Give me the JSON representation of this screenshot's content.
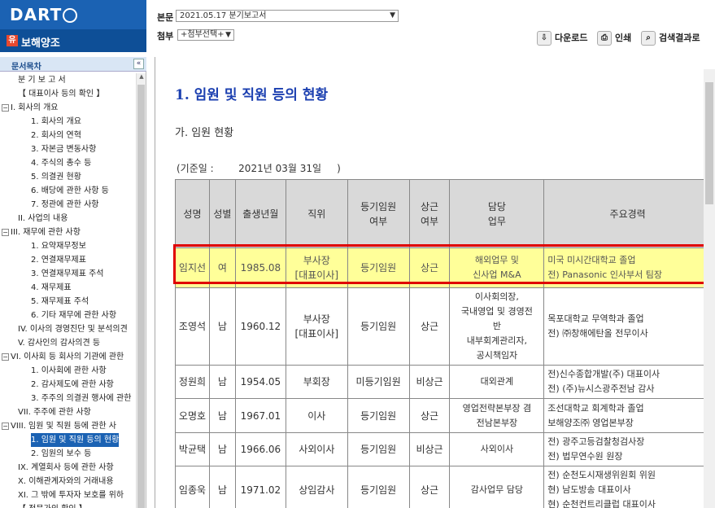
{
  "app": {
    "logo_text": "DART",
    "company": "보해양조",
    "company_icon": "유"
  },
  "header": {
    "doc_label": "본문",
    "doc_value": "2021.05.17  분기보고서",
    "attach_label": "첨부",
    "attach_value": "+첨부선택+",
    "download_label": "다운로드",
    "print_label": "인쇄",
    "search_result_label": "검색결과로"
  },
  "sidebar": {
    "title": "문서목차",
    "collapse": "«",
    "items": [
      {
        "label": "분 기 보 고 서",
        "indent": 1,
        "toggle": ""
      },
      {
        "label": "【 대표이사 등의 확인 】",
        "indent": 1,
        "toggle": ""
      },
      {
        "label": "I. 회사의 개요",
        "indent": 0,
        "toggle": "−"
      },
      {
        "label": "1. 회사의 개요",
        "indent": 2,
        "toggle": ""
      },
      {
        "label": "2. 회사의 연혁",
        "indent": 2,
        "toggle": ""
      },
      {
        "label": "3. 자본금 변동사항",
        "indent": 2,
        "toggle": ""
      },
      {
        "label": "4. 주식의 총수 등",
        "indent": 2,
        "toggle": ""
      },
      {
        "label": "5. 의결권 현황",
        "indent": 2,
        "toggle": ""
      },
      {
        "label": "6. 배당에 관한 사항 등",
        "indent": 2,
        "toggle": ""
      },
      {
        "label": "7. 정관에 관한 사항",
        "indent": 2,
        "toggle": ""
      },
      {
        "label": "II. 사업의 내용",
        "indent": 1,
        "toggle": ""
      },
      {
        "label": "III. 재무에 관한 사항",
        "indent": 0,
        "toggle": "−"
      },
      {
        "label": "1. 요약재무정보",
        "indent": 2,
        "toggle": ""
      },
      {
        "label": "2. 연결재무제표",
        "indent": 2,
        "toggle": ""
      },
      {
        "label": "3. 연결재무제표 주석",
        "indent": 2,
        "toggle": ""
      },
      {
        "label": "4. 재무제표",
        "indent": 2,
        "toggle": ""
      },
      {
        "label": "5. 재무제표 주석",
        "indent": 2,
        "toggle": ""
      },
      {
        "label": "6. 기타 재무에 관한 사항",
        "indent": 2,
        "toggle": ""
      },
      {
        "label": "IV. 이사의 경영진단 및 분석의견",
        "indent": 1,
        "toggle": ""
      },
      {
        "label": "V. 감사인의 감사의견 등",
        "indent": 1,
        "toggle": ""
      },
      {
        "label": "VI. 이사회 등 회사의 기관에 관한",
        "indent": 0,
        "toggle": "−"
      },
      {
        "label": "1. 이사회에 관한 사항",
        "indent": 2,
        "toggle": ""
      },
      {
        "label": "2. 감사제도에 관한 사항",
        "indent": 2,
        "toggle": ""
      },
      {
        "label": "3. 주주의 의결권 행사에 관한",
        "indent": 2,
        "toggle": ""
      },
      {
        "label": "VII. 주주에 관한 사항",
        "indent": 1,
        "toggle": ""
      },
      {
        "label": "VIII. 임원 및 직원 등에 관한 사",
        "indent": 0,
        "toggle": "−"
      },
      {
        "label": "1. 임원 및 직원 등의 현황",
        "indent": 2,
        "toggle": "",
        "active": true
      },
      {
        "label": "2. 임원의 보수 등",
        "indent": 2,
        "toggle": ""
      },
      {
        "label": "IX. 계열회사 등에 관한 사항",
        "indent": 1,
        "toggle": ""
      },
      {
        "label": "X. 이해관계자와의 거래내용",
        "indent": 1,
        "toggle": ""
      },
      {
        "label": "XI. 그 밖에 투자자 보호를 위하",
        "indent": 1,
        "toggle": ""
      },
      {
        "label": "【 전문가의 확인 】",
        "indent": 1,
        "toggle": ""
      }
    ]
  },
  "main": {
    "heading": "1. 임원 및 직원 등의 현황",
    "subheading": "가. 임원 현황",
    "base_date": "(기준일 :        2021년 03월 31일     )",
    "columns": [
      "성명",
      "성별",
      "출생년월",
      "직위",
      "등기임원\n여부",
      "상근\n여부",
      "담당\n업무",
      "주요경력"
    ],
    "rows": [
      {
        "name": "임지선",
        "gender": "여",
        "birth": "1985.08",
        "position": "부사장\n[대표이사]",
        "registered": "등기임원",
        "fulltime": "상근",
        "duty": "해외업무 및\n신사업 M&A",
        "career": "미국 미시간대학교 졸업\n전) Panasonic 인사부서 팀장",
        "highlight": true
      },
      {
        "name": "조영석",
        "gender": "남",
        "birth": "1960.12",
        "position": "부사장\n[대표이사]",
        "registered": "등기임원",
        "fulltime": "상근",
        "duty": "이사회의장,\n국내영업 및 경영전\n반\n내부회계관리자,\n공시책임자",
        "career": "목포대학교 무역학과 졸업\n전) ㈜창해에탄올 전무이사"
      },
      {
        "name": "정원희",
        "gender": "남",
        "birth": "1954.05",
        "position": "부회장",
        "registered": "미등기임원",
        "fulltime": "비상근",
        "duty": "대외관계",
        "career": "전)신수종합개발(주) 대표이사\n전) (주)뉴시스광주전남 감사"
      },
      {
        "name": "오명호",
        "gender": "남",
        "birth": "1967.01",
        "position": "이사",
        "registered": "등기임원",
        "fulltime": "상근",
        "duty": "영업전략본부장 겸\n전남본부장",
        "career": "조선대학교 회계학과 졸업\n보해양조㈜ 영업본부장"
      },
      {
        "name": "박균택",
        "gender": "남",
        "birth": "1966.06",
        "position": "사외이사",
        "registered": "등기임원",
        "fulltime": "비상근",
        "duty": "사외이사",
        "career": "전) 광주고등검찰청검사장\n전) 법무연수원 원장"
      },
      {
        "name": "임종욱",
        "gender": "남",
        "birth": "1971.02",
        "position": "상임감사",
        "registered": "등기임원",
        "fulltime": "상근",
        "duty": "감사업무 담당",
        "career": "전) 순천도시재생위원회 위원\n현) 남도방송 대표이사\n현) 순천컨트리클럽 대표이사"
      }
    ]
  }
}
